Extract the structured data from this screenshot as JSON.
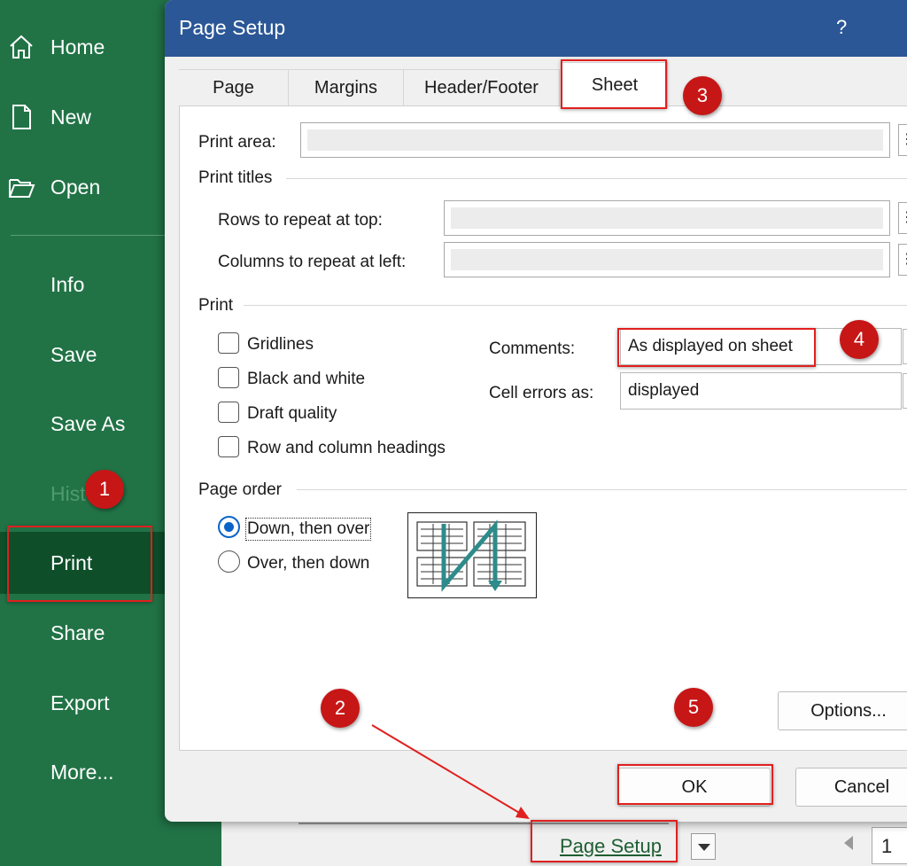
{
  "sidebar": {
    "items": [
      {
        "label": "Home",
        "icon": "home-icon"
      },
      {
        "label": "New",
        "icon": "new-document-icon"
      },
      {
        "label": "Open",
        "icon": "open-folder-icon"
      },
      {
        "label": "Info"
      },
      {
        "label": "Save"
      },
      {
        "label": "Save As"
      },
      {
        "label": "Hist"
      },
      {
        "label": "Print",
        "selected": true
      },
      {
        "label": "Share"
      },
      {
        "label": "Export"
      },
      {
        "label": "More..."
      }
    ]
  },
  "dialog": {
    "title": "Page Setup",
    "help": "?",
    "tabs": [
      {
        "label": "Page"
      },
      {
        "label": "Margins"
      },
      {
        "label": "Header/Footer"
      },
      {
        "label": "Sheet",
        "active": true
      }
    ],
    "print_area_label": "Print area:",
    "print_titles_heading": "Print titles",
    "rows_label": "Rows to repeat at top:",
    "columns_label": "Columns to repeat at left:",
    "print_heading": "Print",
    "checkboxes": [
      {
        "label": "Gridlines",
        "checked": false
      },
      {
        "label": "Black and white",
        "checked": false
      },
      {
        "label": "Draft quality",
        "checked": false
      },
      {
        "label": "Row and column headings",
        "checked": false
      }
    ],
    "comments_label": "Comments:",
    "comments_value": "As displayed on sheet",
    "cell_errors_label": "Cell errors as:",
    "cell_errors_value": "displayed",
    "page_order_heading": "Page order",
    "radios": [
      {
        "label": "Down, then over",
        "checked": true
      },
      {
        "label": "Over, then down",
        "checked": false
      }
    ],
    "options_button": "Options...",
    "ok_button": "OK",
    "cancel_button": "Cancel"
  },
  "backstage": {
    "page_setup_link": "Page Setup",
    "page_number": "1"
  },
  "annotations": {
    "badges": [
      "1",
      "2",
      "3",
      "4",
      "5"
    ],
    "color": "#c71616"
  },
  "colors": {
    "sidebar_bg": "#217346",
    "sidebar_selected": "#0e4f2a",
    "titlebar": "#2b5797",
    "highlight": "#e0201f"
  }
}
